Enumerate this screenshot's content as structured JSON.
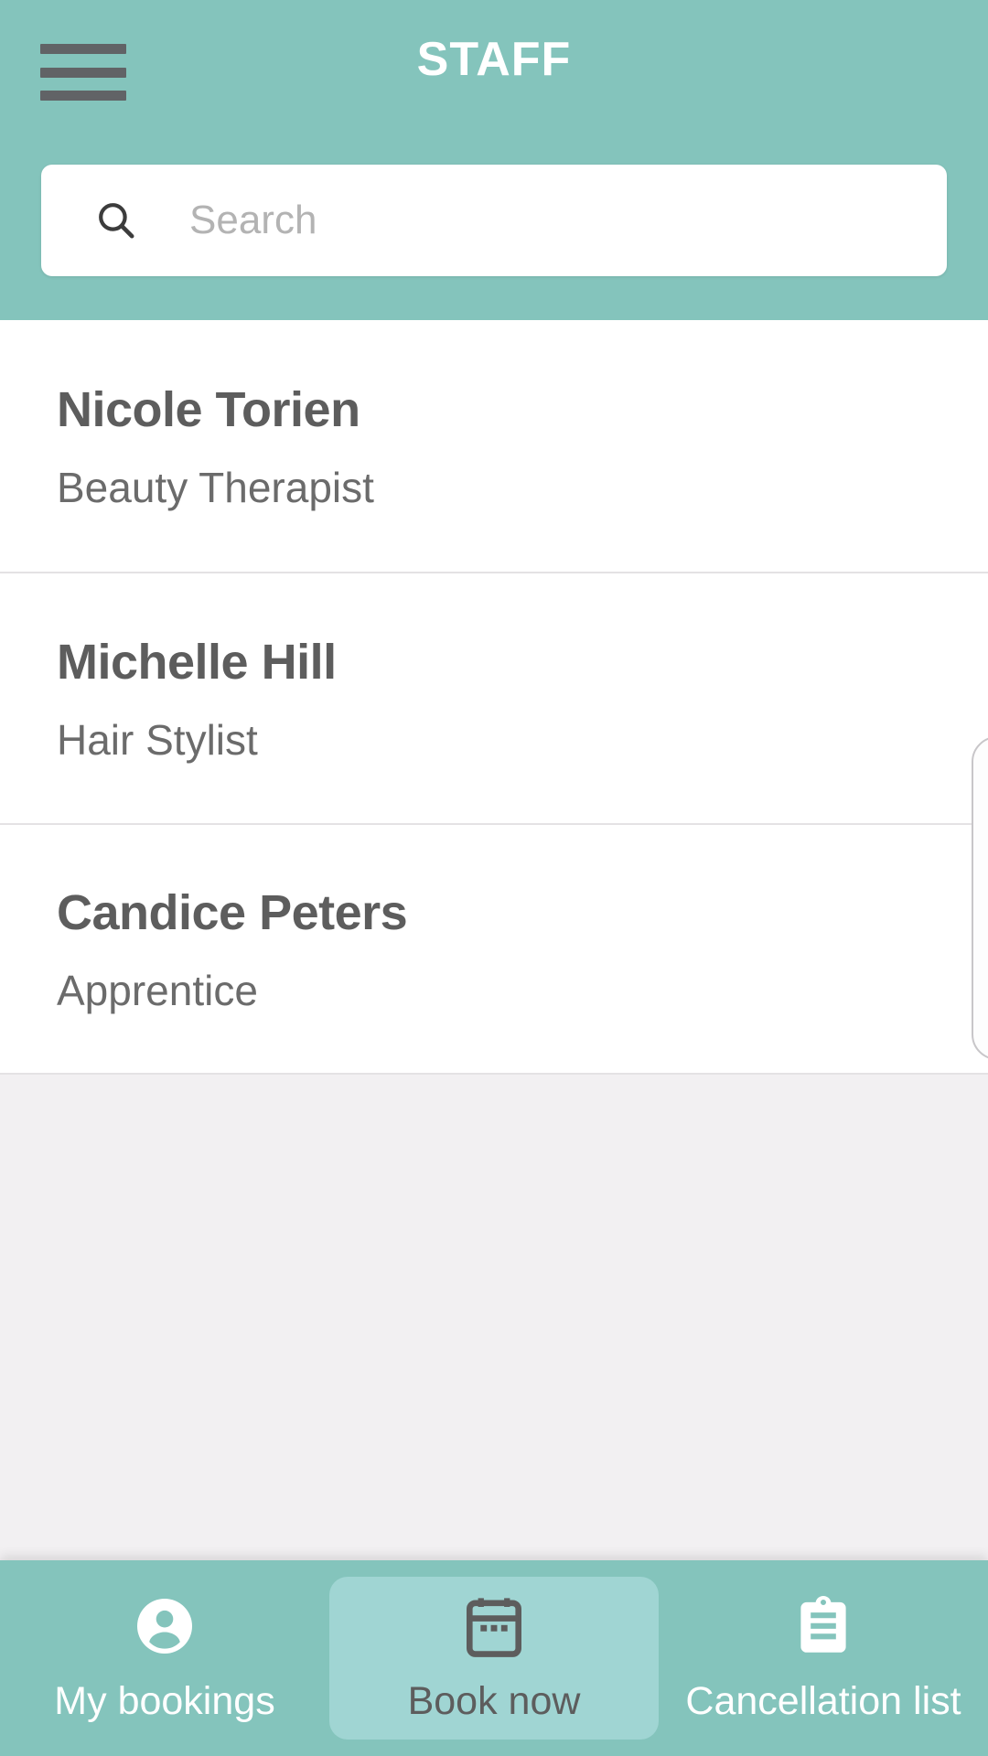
{
  "header": {
    "title": "STAFF",
    "menu_icon": "hamburger-menu-icon",
    "background_color": "#84C4BC",
    "title_color": "#FFFFFF"
  },
  "search": {
    "placeholder": "Search",
    "value": "",
    "icon": "search-icon"
  },
  "staff_list": [
    {
      "name": "Nicole Torien",
      "role": "Beauty Therapist"
    },
    {
      "name": "Michelle Hill",
      "role": "Hair Stylist"
    },
    {
      "name": "Candice Peters",
      "role": "Apprentice"
    }
  ],
  "bottom_nav": {
    "active_index": 1,
    "items": [
      {
        "label": "My bookings",
        "icon": "person-circle-icon",
        "active": false
      },
      {
        "label": "Book now",
        "icon": "calendar-icon",
        "active": true
      },
      {
        "label": "Cancellation list",
        "icon": "clipboard-icon",
        "active": false
      }
    ],
    "background_color": "#84C4BC",
    "active_tile_color": "#A0D5D3"
  }
}
